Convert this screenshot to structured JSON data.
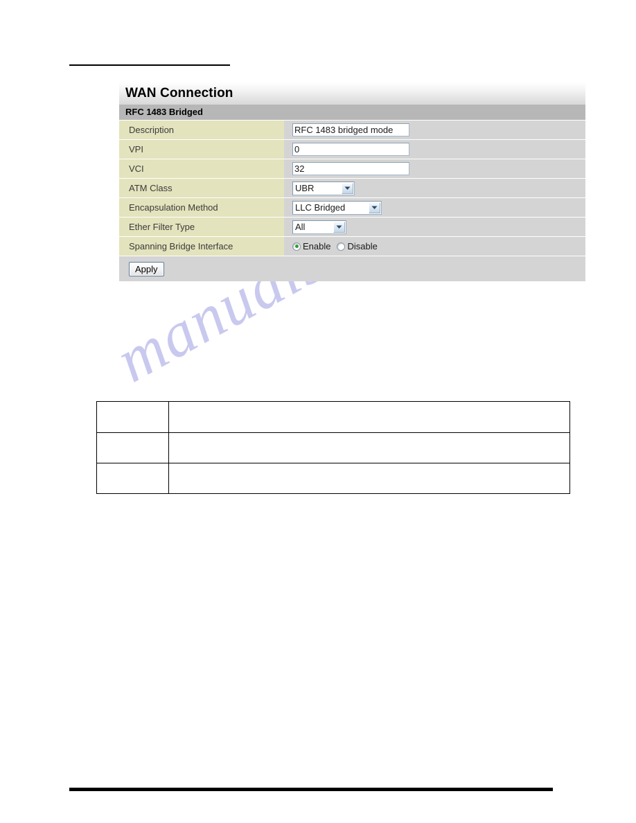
{
  "page": {
    "watermark_text": "manualshive.com",
    "top_rule": true,
    "bottom_rule": true
  },
  "panel": {
    "title": "WAN Connection",
    "subtitle": "RFC 1483 Bridged",
    "rows": [
      {
        "label": "Description",
        "control": "text",
        "name": "description",
        "value": "RFC 1483 bridged mode"
      },
      {
        "label": "VPI",
        "control": "text",
        "name": "vpi",
        "value": "0"
      },
      {
        "label": "VCI",
        "control": "text",
        "name": "vci",
        "value": "32"
      },
      {
        "label": "ATM Class",
        "control": "select",
        "name": "atm-class",
        "value": "UBR"
      },
      {
        "label": "Encapsulation Method",
        "control": "select",
        "name": "encapsulation-method",
        "value": "LLC Bridged"
      },
      {
        "label": "Ether Filter Type",
        "control": "select",
        "name": "ether-filter-type",
        "value": "All"
      },
      {
        "label": "Spanning Bridge Interface",
        "control": "radio",
        "name": "spanning-bridge-interface",
        "options": [
          {
            "label": "Enable",
            "selected": true
          },
          {
            "label": "Disable",
            "selected": false
          }
        ]
      }
    ],
    "apply_label": "Apply"
  },
  "blank_table": {
    "rows": [
      {
        "col1": "",
        "col2": ""
      },
      {
        "col1": "",
        "col2": ""
      },
      {
        "col1": "",
        "col2": ""
      }
    ]
  },
  "colors": {
    "panel_body": "#d4d4d4",
    "subtitle_bar": "#b7b7b7",
    "label_cell": "#e3e3bd",
    "radio_selected": "#2f9e2f",
    "watermark": "#c9c9ef",
    "input_border": "#a4b7c8"
  }
}
